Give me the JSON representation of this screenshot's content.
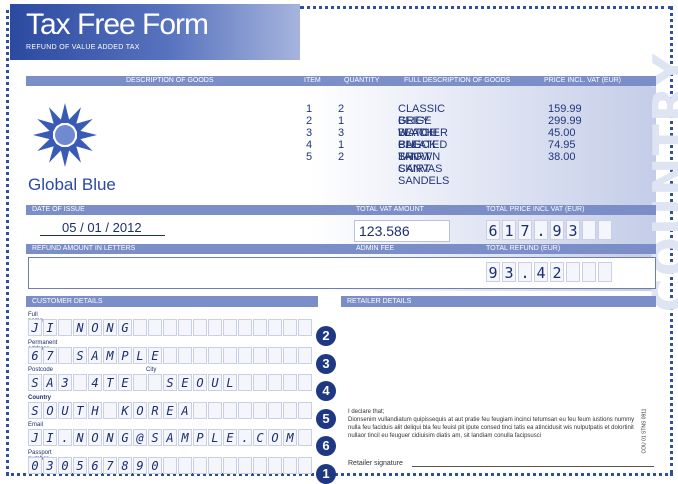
{
  "header": {
    "title": "Tax Free Form",
    "subtitle": "REFUND OF VALUE ADDED TAX"
  },
  "goods_table": {
    "headers": {
      "description": "DESCRIPTION OF GOODS",
      "item": "ITEM",
      "quantity": "QUANTITY",
      "full_description": "FULL DESCRIPTION OF GOODS",
      "price": "PRICE INCL. VAT (EUR)"
    },
    "rows": [
      {
        "item": "1",
        "quantity": "2",
        "description": "CLASSIC GREY WATCH",
        "price": "159.99"
      },
      {
        "item": "2",
        "quantity": "1",
        "description": "BEIGE LEATHER BAG",
        "price": "299.99"
      },
      {
        "item": "3",
        "quantity": "3",
        "description": "BLACK CHECK SHIRT",
        "price": "45.00"
      },
      {
        "item": "4",
        "quantity": "1",
        "description": "PLEATED BROWN SKIRT",
        "price": "74.95"
      },
      {
        "item": "5",
        "quantity": "2",
        "description": "TAN CANVAS SANDELS",
        "price": "38.00"
      }
    ]
  },
  "logo_text": "Global Blue",
  "country_word": "COUNTRY",
  "summary": {
    "date_label": "DATE OF ISSUE",
    "date_day": "05",
    "date_month": "01",
    "date_year": "2012",
    "total_vat_label": "TOTAL VAT AMOUNT",
    "total_vat_value": "123.586",
    "total_price_label": "TOTAL PRICE INCL VAT (EUR)",
    "total_price_chars": [
      "6",
      "1",
      "7",
      ".",
      "9",
      "3",
      "",
      ""
    ],
    "refund_letters_label": "REFUND AMOUNT IN LETTERS",
    "admin_fee_label": "ADMIN FEE",
    "total_refund_label": "TOTAL REFUND (EUR)",
    "total_refund_chars": [
      "9",
      "3",
      ".",
      "4",
      "2",
      "",
      "",
      ""
    ]
  },
  "customer": {
    "section_label": "CUSTOMER DETAILS",
    "fields": [
      {
        "label": "Full name",
        "chars": [
          "J",
          "I",
          "",
          "N",
          "O",
          "N",
          "G",
          "",
          "",
          "",
          "",
          "",
          "",
          "",
          "",
          "",
          "",
          "",
          ""
        ],
        "badge": "2"
      },
      {
        "label": "Permanent address",
        "chars": [
          "6",
          "7",
          "",
          "S",
          "A",
          "M",
          "P",
          "L",
          "E",
          "",
          "",
          "",
          "",
          "",
          "",
          "",
          "",
          "",
          ""
        ],
        "badge": "3"
      },
      {
        "label": "Postcode",
        "label2": "City",
        "chars": [
          "S",
          "A",
          "3",
          "",
          "4",
          "T",
          "E",
          "",
          "",
          "S",
          "E",
          "O",
          "U",
          "L",
          "",
          "",
          "",
          "",
          ""
        ],
        "badge": "4"
      },
      {
        "label": "Country",
        "chars": [
          "S",
          "O",
          "U",
          "T",
          "H",
          "",
          "K",
          "O",
          "R",
          "E",
          "A",
          "",
          "",
          "",
          "",
          "",
          "",
          "",
          ""
        ],
        "badge": "5"
      },
      {
        "label": "Email",
        "chars": [
          "J",
          "I",
          ".",
          "N",
          "O",
          "N",
          "G",
          "@",
          "S",
          "A",
          "M",
          "P",
          "L",
          "E",
          ".",
          "C",
          "O",
          "M",
          ""
        ],
        "badge": "6"
      },
      {
        "label": "Passport number",
        "chars": [
          "0",
          "3",
          "0",
          "5",
          "6",
          "7",
          "8",
          "9",
          "0",
          "",
          "",
          "",
          "",
          "",
          "",
          "",
          "",
          "",
          ""
        ],
        "badge": "1"
      }
    ]
  },
  "retailer": {
    "section_label": "RETAILER DETAILS",
    "declare_heading": "I declare that;",
    "declare_text": "Dionsenim vullandiatum quipissequis at aut pratie feu feugiam incinci tetumsan eu feu feum iustions nummy nulla feu faciduis alit deliqui bla feu feuisl pit ipute consed tinci tatis ea atincidusit wis nulputpatis et dolortinit nullaor tincil eu feuguer cidiuisim diatis am, sit landiam conulla facipsusci",
    "signature_label": "Retailer signature",
    "side_code": "COU 01 STNS 0911"
  },
  "colors": {
    "brand_blue": "#2b4aa0",
    "bar_blue": "#7b8ec8",
    "badge_blue": "#1e3884"
  }
}
